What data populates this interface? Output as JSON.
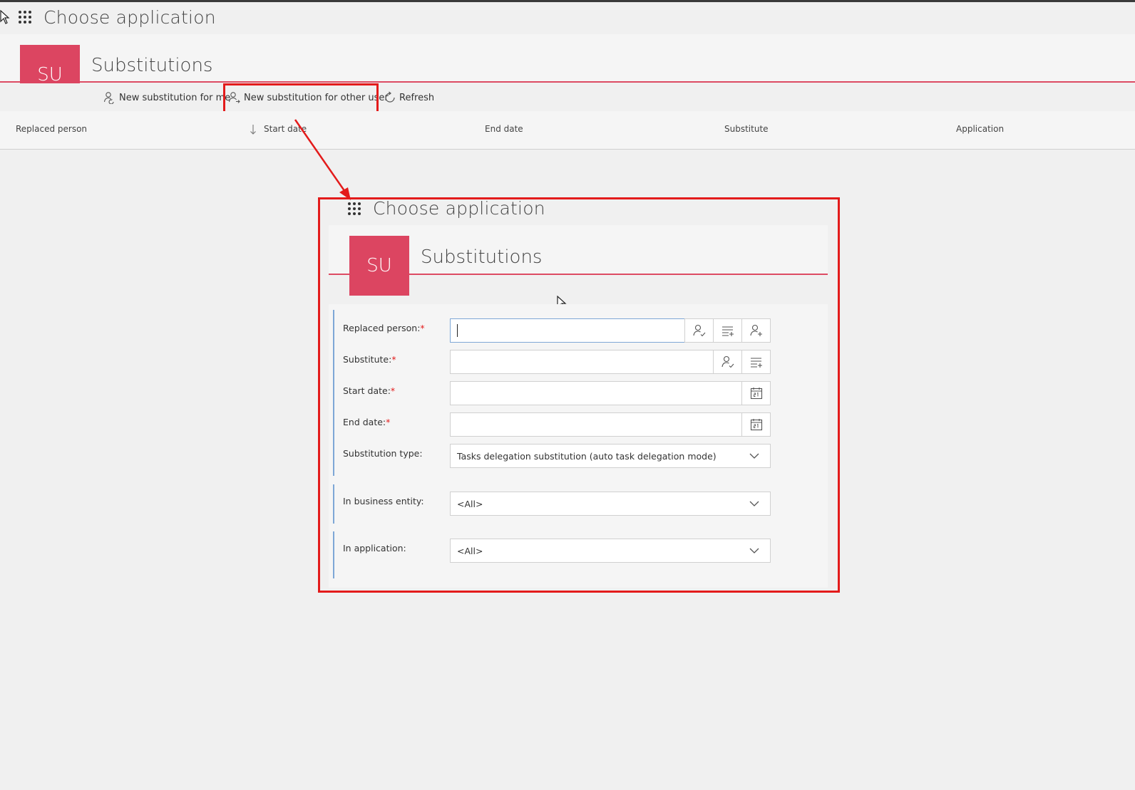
{
  "header": {
    "app_chooser_label": "Choose application",
    "tile_initials": "SU",
    "module_title": "Substitutions"
  },
  "toolbar": {
    "new_for_me": "New substitution for me",
    "new_for_other": "New substitution for other user",
    "refresh": "Refresh"
  },
  "table": {
    "columns": [
      "Replaced person",
      "Start date",
      "End date",
      "Substitute",
      "Application"
    ],
    "sort_column": "Start date"
  },
  "dialog": {
    "app_chooser_label": "Choose application",
    "tile_initials": "SU",
    "module_title": "Substitutions",
    "fields": {
      "replaced_person": {
        "label": "Replaced person:",
        "required_mark": "*",
        "value": ""
      },
      "substitute": {
        "label": "Substitute:",
        "required_mark": "*",
        "value": ""
      },
      "start_date": {
        "label": "Start date:",
        "required_mark": "*",
        "value": ""
      },
      "end_date": {
        "label": "End date:",
        "required_mark": "*",
        "value": ""
      },
      "substitution_type": {
        "label": "Substitution type:",
        "value": "Tasks delegation substitution (auto task delegation mode)"
      },
      "business_entity": {
        "label": "In business entity:",
        "value": "<All>"
      },
      "application": {
        "label": "In application:",
        "value": "<All>"
      }
    }
  },
  "colors": {
    "brand": "#dc4561",
    "highlight": "#e31b1b",
    "group_accent": "#7ea7d6"
  },
  "icons": {
    "app_launcher": "waffle-icon",
    "person_check": "person-check-icon",
    "person_add": "person-add-icon",
    "list_add": "list-add-icon",
    "calendar": "calendar-icon",
    "refresh": "refresh-icon",
    "chevron": "chevron-down-icon"
  }
}
